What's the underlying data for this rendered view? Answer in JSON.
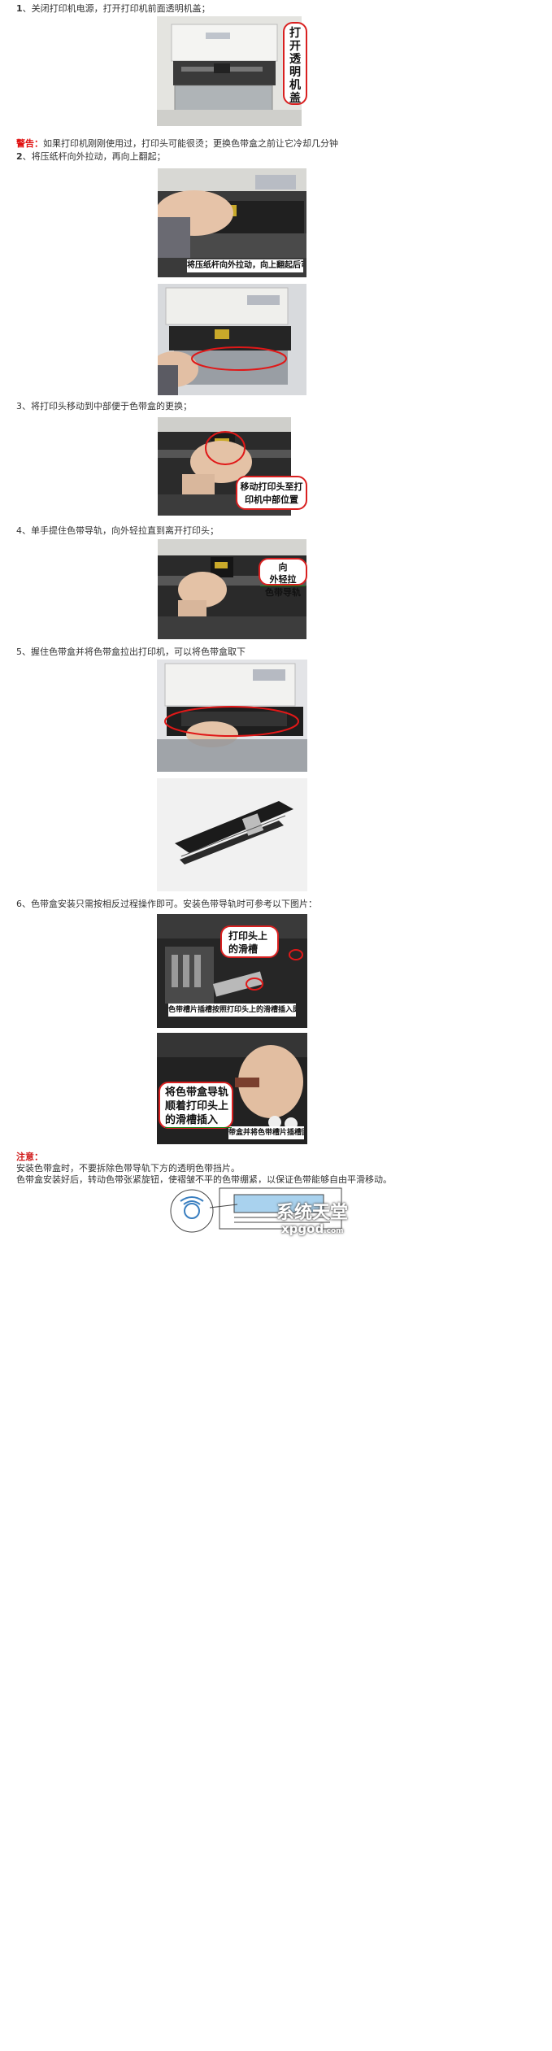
{
  "steps": {
    "s1": {
      "num": "1",
      "text": "、关闭打印机电源，打开打印机前面透明机盖；"
    },
    "warning": {
      "label": "警告：",
      "text": "如果打印机刚刚使用过，打印头可能很烫；更换色带盒之前让它冷却几分钟"
    },
    "s2": {
      "num": "2",
      "text": "、将压纸杆向外拉动，再向上翻起；"
    },
    "s3": {
      "text": "3、将打印头移动到中部便于色带盒的更换；"
    },
    "s4": {
      "text": "4、单手提住色带导轨，向外轻拉直到离开打印头；"
    },
    "s5": {
      "text": "5、握住色带盒并将色带盒拉出打印机，可以将色带盒取下"
    },
    "s6": {
      "text": "6、色带盒安装只需按相反过程操作即可。安装色带导轨时可参考以下图片："
    }
  },
  "callouts": {
    "open_cover": [
      "打",
      "开",
      "透",
      "明",
      "机",
      "盖"
    ],
    "move_head": [
      "移动打印头至打",
      "印机中部位置"
    ],
    "pull_guide": {
      "prefix": "向",
      "underlined": "外轻拉",
      "line2": "色带导轨"
    },
    "head_slot": [
      "打印头上",
      "的滑槽"
    ],
    "insert": {
      "line1": "将色带盒导轨",
      "line2": "顺着打印头上",
      "line3_underlined": "的滑槽插入"
    }
  },
  "captions": {
    "lever": "将压纸杆向外拉动，向上翻起后可以立起",
    "guide_pins": "色带槽片插槽按照打印头上的滑槽插入即可",
    "guide_fixed": "带盒并将色带槽片插槽固定在打印头上"
  },
  "notes": {
    "label": "注意：",
    "line1": "安装色带盒时，不要拆除色带导轨下方的透明色带挡片。",
    "line2": "色带盒安装好后，转动色带张紧旋钮，使褶皱不平的色带绷紧，以保证色带能够自由平滑移动。"
  },
  "watermark": {
    "main": "系统天堂",
    "sub": "xpgod",
    "domain": ".com"
  },
  "colors": {
    "warning_red": "#e01010",
    "callout_border": "#d92020",
    "highlight_ellipse": "#e01818"
  }
}
